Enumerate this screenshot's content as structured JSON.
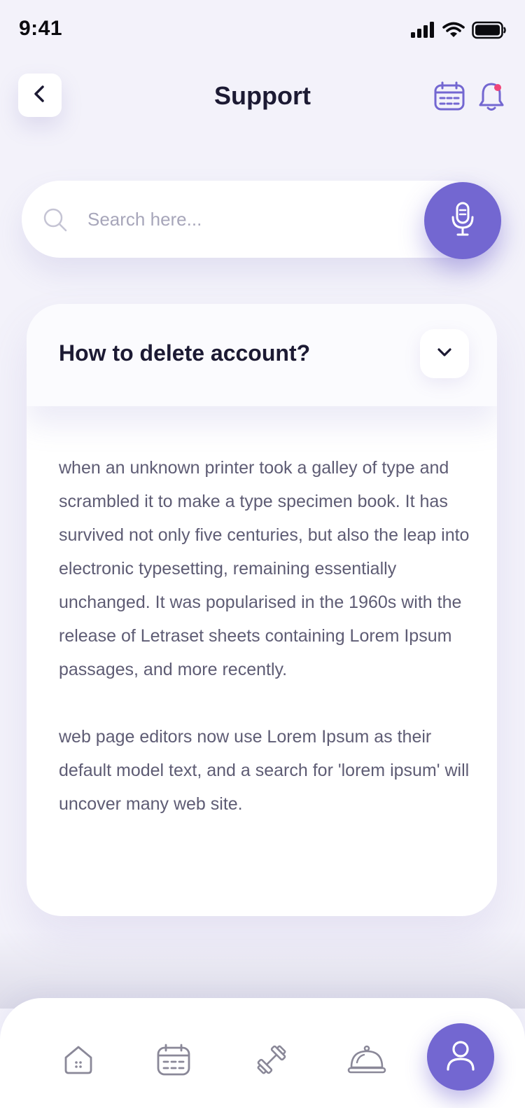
{
  "status_bar": {
    "time": "9:41"
  },
  "header": {
    "title": "Support",
    "icons": [
      "back-icon",
      "calendar-icon",
      "bell-icon"
    ],
    "has_notification_dot": true
  },
  "search": {
    "placeholder": "Search here...",
    "value": "",
    "icons": [
      "search-icon",
      "microphone-icon"
    ]
  },
  "faq": {
    "question": "How to delete account?",
    "expanded": true,
    "answer_paragraphs": [
      "when an unknown printer took a galley of type and scrambled it to make a type specimen book. It has survived not only five centuries, but also the leap into electronic typesetting, remaining essentially unchanged. It was popularised in the 1960s with the release of Letraset sheets containing Lorem Ipsum passages, and more recently.",
      "web page editors now use Lorem Ipsum as their default model text, and a search for 'lorem ipsum' will uncover many web site."
    ]
  },
  "bottom_nav": {
    "items": [
      "home-icon",
      "calendar-icon",
      "dumbbell-icon",
      "food-cloche-icon",
      "profile-icon"
    ],
    "active": "profile-icon"
  },
  "colors": {
    "accent": "#7367D1",
    "background": "#F3F2FA",
    "notification_dot": "#F0457A",
    "text_primary": "#1C1A33",
    "text_body": "#5E5C74"
  }
}
